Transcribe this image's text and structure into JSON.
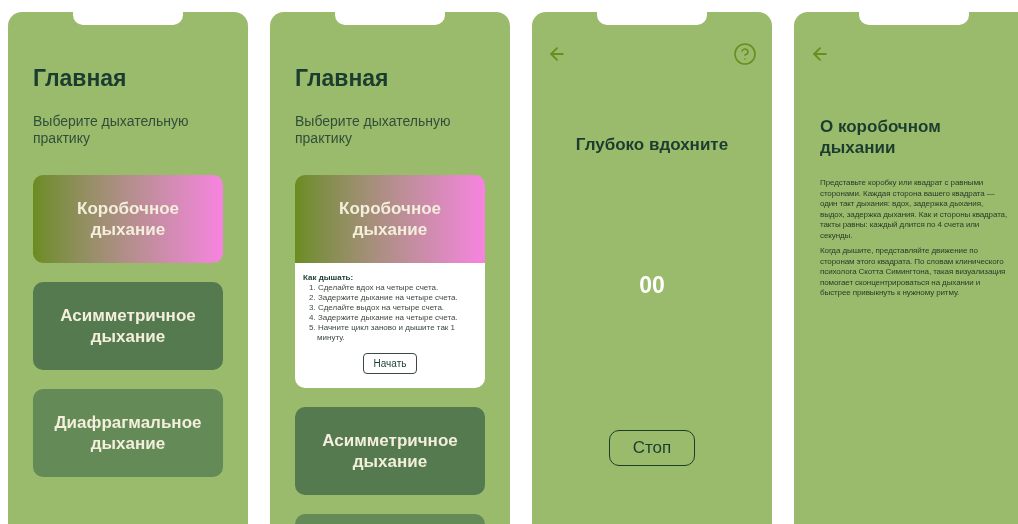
{
  "screens": [
    {
      "kind": "home",
      "title": "Главная",
      "subtitle": "Выберите дыхательную практику",
      "practices": [
        {
          "name": "Коробочное дыхание",
          "kind": "gradient",
          "expanded": false
        },
        {
          "name": "Асимметричное дыхание",
          "kind": "dark",
          "expanded": false
        },
        {
          "name": "Диафрагмальное дыхание",
          "kind": "mid",
          "expanded": false
        }
      ]
    },
    {
      "kind": "home",
      "title": "Главная",
      "subtitle": "Выберите дыхательную практику",
      "practices": [
        {
          "name": "Коробочное дыхание",
          "kind": "gradient",
          "expanded": true,
          "instructions_heading": "Как дышать:",
          "steps": [
            "1. Сделайте вдох на четыре счета.",
            "2. Задержите дыхание на четыре счета.",
            "3. Сделайте выдох на четыре счета.",
            "4. Задержите дыхание на четыре счета.",
            "5. Начните цикл заново и дышите так 1 минуту."
          ],
          "button": "Начать"
        },
        {
          "name": "Асимметричное дыхание",
          "kind": "dark",
          "expanded": false
        },
        {
          "kind": "mid",
          "expanded": false
        }
      ]
    },
    {
      "kind": "exercise",
      "title": "Глубоко вдохните",
      "counter": "00",
      "button": "Стоп"
    },
    {
      "kind": "info",
      "title": "О коробочном дыхании",
      "paragraphs": [
        "Представьте коробку или квадрат с равными сторонами. Каждая сторона вашего квадрата — один такт дыхания: вдох, задержка дыхания, выдох, задержка дыхания. Как и стороны квадрата, такты равны: каждый длится по 4 счета или секунды.",
        "Когда дышите, представляйте движение по сторонам этого квадрата. По словам клинического психолога Скотта Симингтона, такая визуализация помогает сконцентрироваться на дыхании и быстрее привыкнуть к нужному ритму."
      ]
    }
  ]
}
